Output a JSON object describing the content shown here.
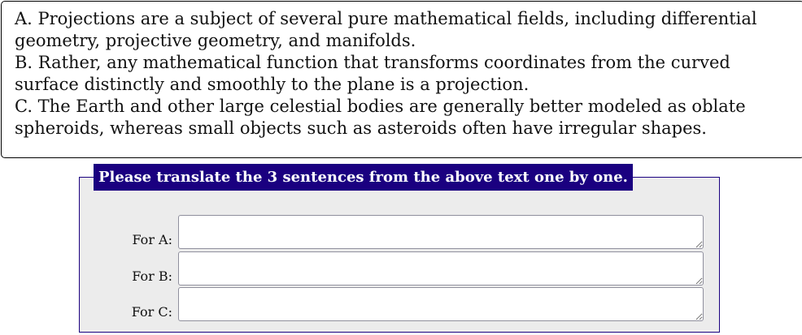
{
  "passage": [
    "A. Projections are a subject of several pure mathematical fields, including differential geometry, projective geometry, and manifolds.",
    "B. Rather, any mathematical function that transforms coordinates from the curved surface distinctly and smoothly to the plane is a projection.",
    "C. The Earth and other large celestial bodies are generally better modeled as oblate spheroids, whereas small objects such as asteroids often have irregular shapes."
  ],
  "form": {
    "legend": "Please translate the 3 sentences from the above text one by one.",
    "fields": [
      {
        "label": "For A:",
        "value": ""
      },
      {
        "label": "For B:",
        "value": ""
      },
      {
        "label": "For C:",
        "value": ""
      }
    ]
  }
}
